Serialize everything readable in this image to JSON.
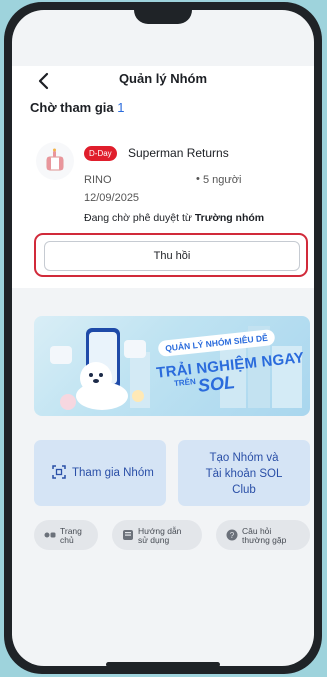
{
  "header": {
    "title": "Quản lý Nhóm"
  },
  "pending": {
    "section_label": "Chờ tham gia",
    "count": "1",
    "item": {
      "badge": "D-Day",
      "name": "Superman Returns",
      "leader": "RINO",
      "bullet": "•",
      "members": "5 người",
      "date": "12/09/2025",
      "status_prefix": "Đang chờ phê duyệt từ",
      "status_bold": "Trường nhóm"
    },
    "withdraw_label": "Thu hồi"
  },
  "banner": {
    "line1": "QUẢN LÝ NHÓM SIÊU DỄ",
    "line2": "TRẢI NGHIỆM NGAY",
    "line3": "TRÊN",
    "line4": "SOL"
  },
  "actions": {
    "join_label": "Tham gia Nhóm",
    "create_label": "Tạo Nhóm và\nTài khoản SOL\nClub"
  },
  "quick_links": [
    {
      "label": "Trang\nchủ",
      "icon": "home-icon"
    },
    {
      "label": "Hướng dẫn\nsử dụng",
      "icon": "guide-icon"
    },
    {
      "label": "Câu hỏi\nthường gặp",
      "icon": "faq-icon"
    }
  ],
  "colors": {
    "accent": "#2a6bdc",
    "badge": "#e01e2c",
    "highlight": "#d12a3a",
    "tile": "#d5e4f5"
  }
}
